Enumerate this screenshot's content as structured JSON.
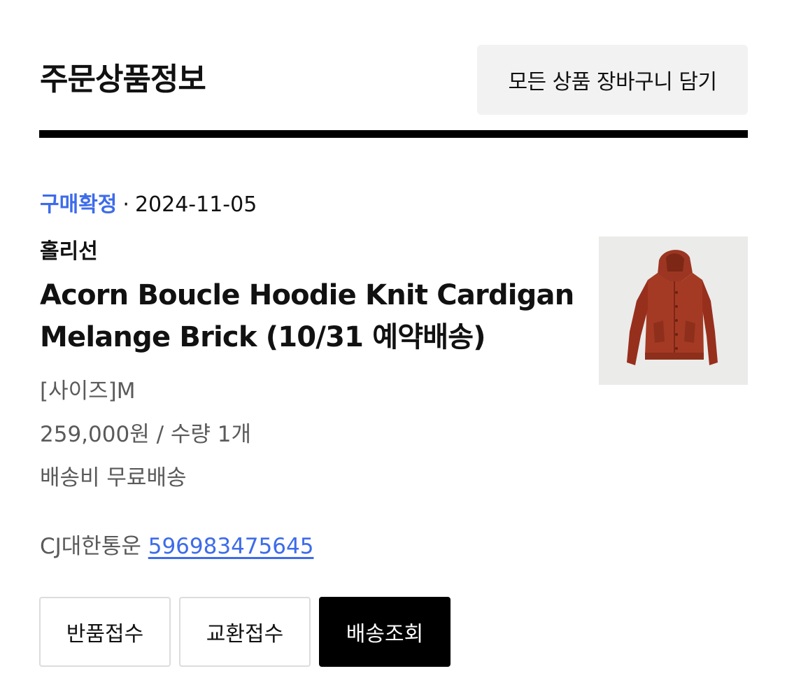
{
  "header": {
    "title": "주문상품정보",
    "cart_all_label": "모든 상품 장바구니 담기"
  },
  "order": {
    "status": "구매확정",
    "separator": "·",
    "date": "2024-11-05",
    "brand": "홀리선",
    "product_name": "Acorn Boucle Hoodie Knit Cardigan Melange Brick (10/31 예약배송)",
    "option": "[사이즈]M",
    "price_qty": "259,000원 / 수량 1개",
    "shipping": "배송비 무료배송",
    "courier": "CJ대한통운",
    "tracking_number": "596983475645",
    "thumbnail_icon": "hoodie-cardigan-product-image"
  },
  "actions": {
    "return_label": "반품접수",
    "exchange_label": "교환접수",
    "track_label": "배송조회"
  },
  "colors": {
    "accent": "#3d6bea",
    "product": "#a53a24"
  }
}
